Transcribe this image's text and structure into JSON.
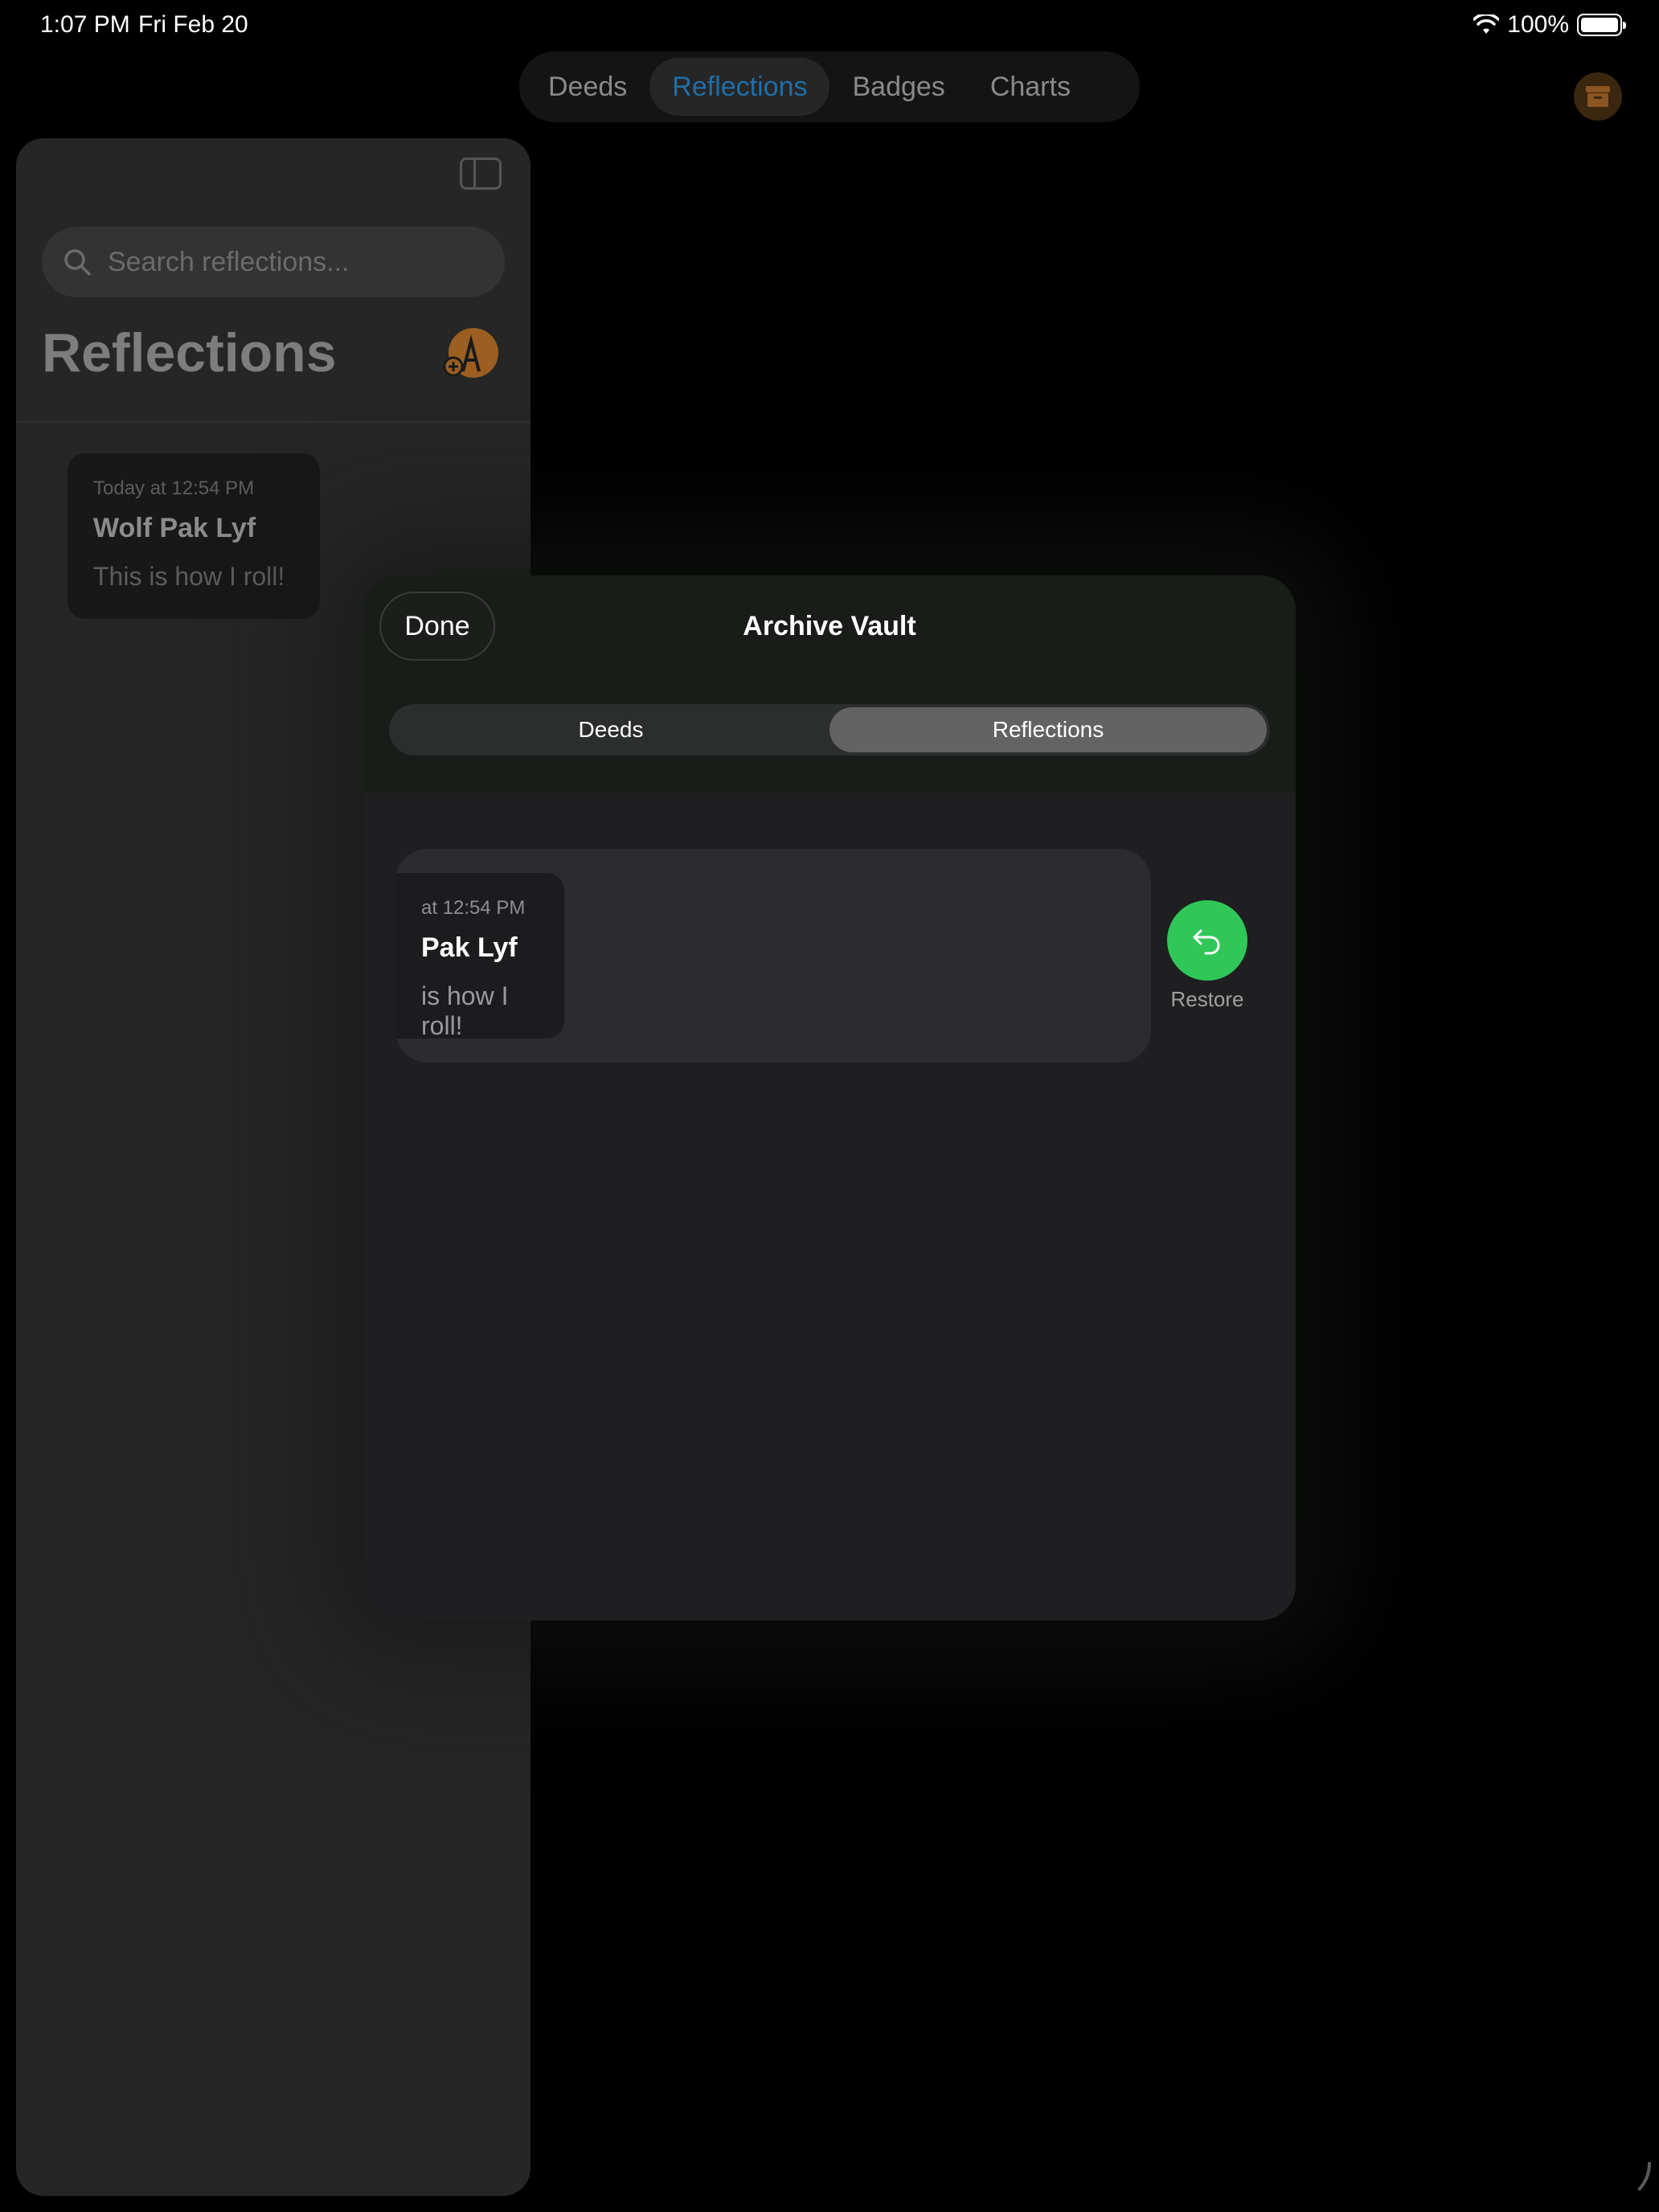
{
  "status_bar": {
    "time": "1:07 PM",
    "date": "Fri Feb 20",
    "battery": "100%"
  },
  "top_tabs": [
    {
      "label": "Deeds",
      "active": false
    },
    {
      "label": "Reflections",
      "active": true
    },
    {
      "label": "Badges",
      "active": false
    },
    {
      "label": "Charts",
      "active": false
    }
  ],
  "sidebar": {
    "search_placeholder": "Search reflections...",
    "title": "Reflections",
    "entries": [
      {
        "date": "Today at 12:54 PM",
        "title": "Wolf Pak Lyf",
        "body": "This is how I roll!"
      }
    ]
  },
  "modal": {
    "done_label": "Done",
    "title": "Archive Vault",
    "segments": [
      {
        "label": "Deeds",
        "active": false
      },
      {
        "label": "Reflections",
        "active": true
      }
    ],
    "archived_entry": {
      "date_visible": "at 12:54 PM",
      "title_visible": "Pak Lyf",
      "body_visible": "is how I roll!"
    },
    "restore_label": "Restore"
  },
  "colors": {
    "accent_tab": "#1f6fa8",
    "restore_green": "#30c758",
    "compose_orange": "#9a5f21"
  },
  "icons": [
    "wifi-icon",
    "battery-icon",
    "archive-icon",
    "sidebar-toggle-icon",
    "search-icon",
    "compose-icon",
    "restore-arrow-icon"
  ]
}
